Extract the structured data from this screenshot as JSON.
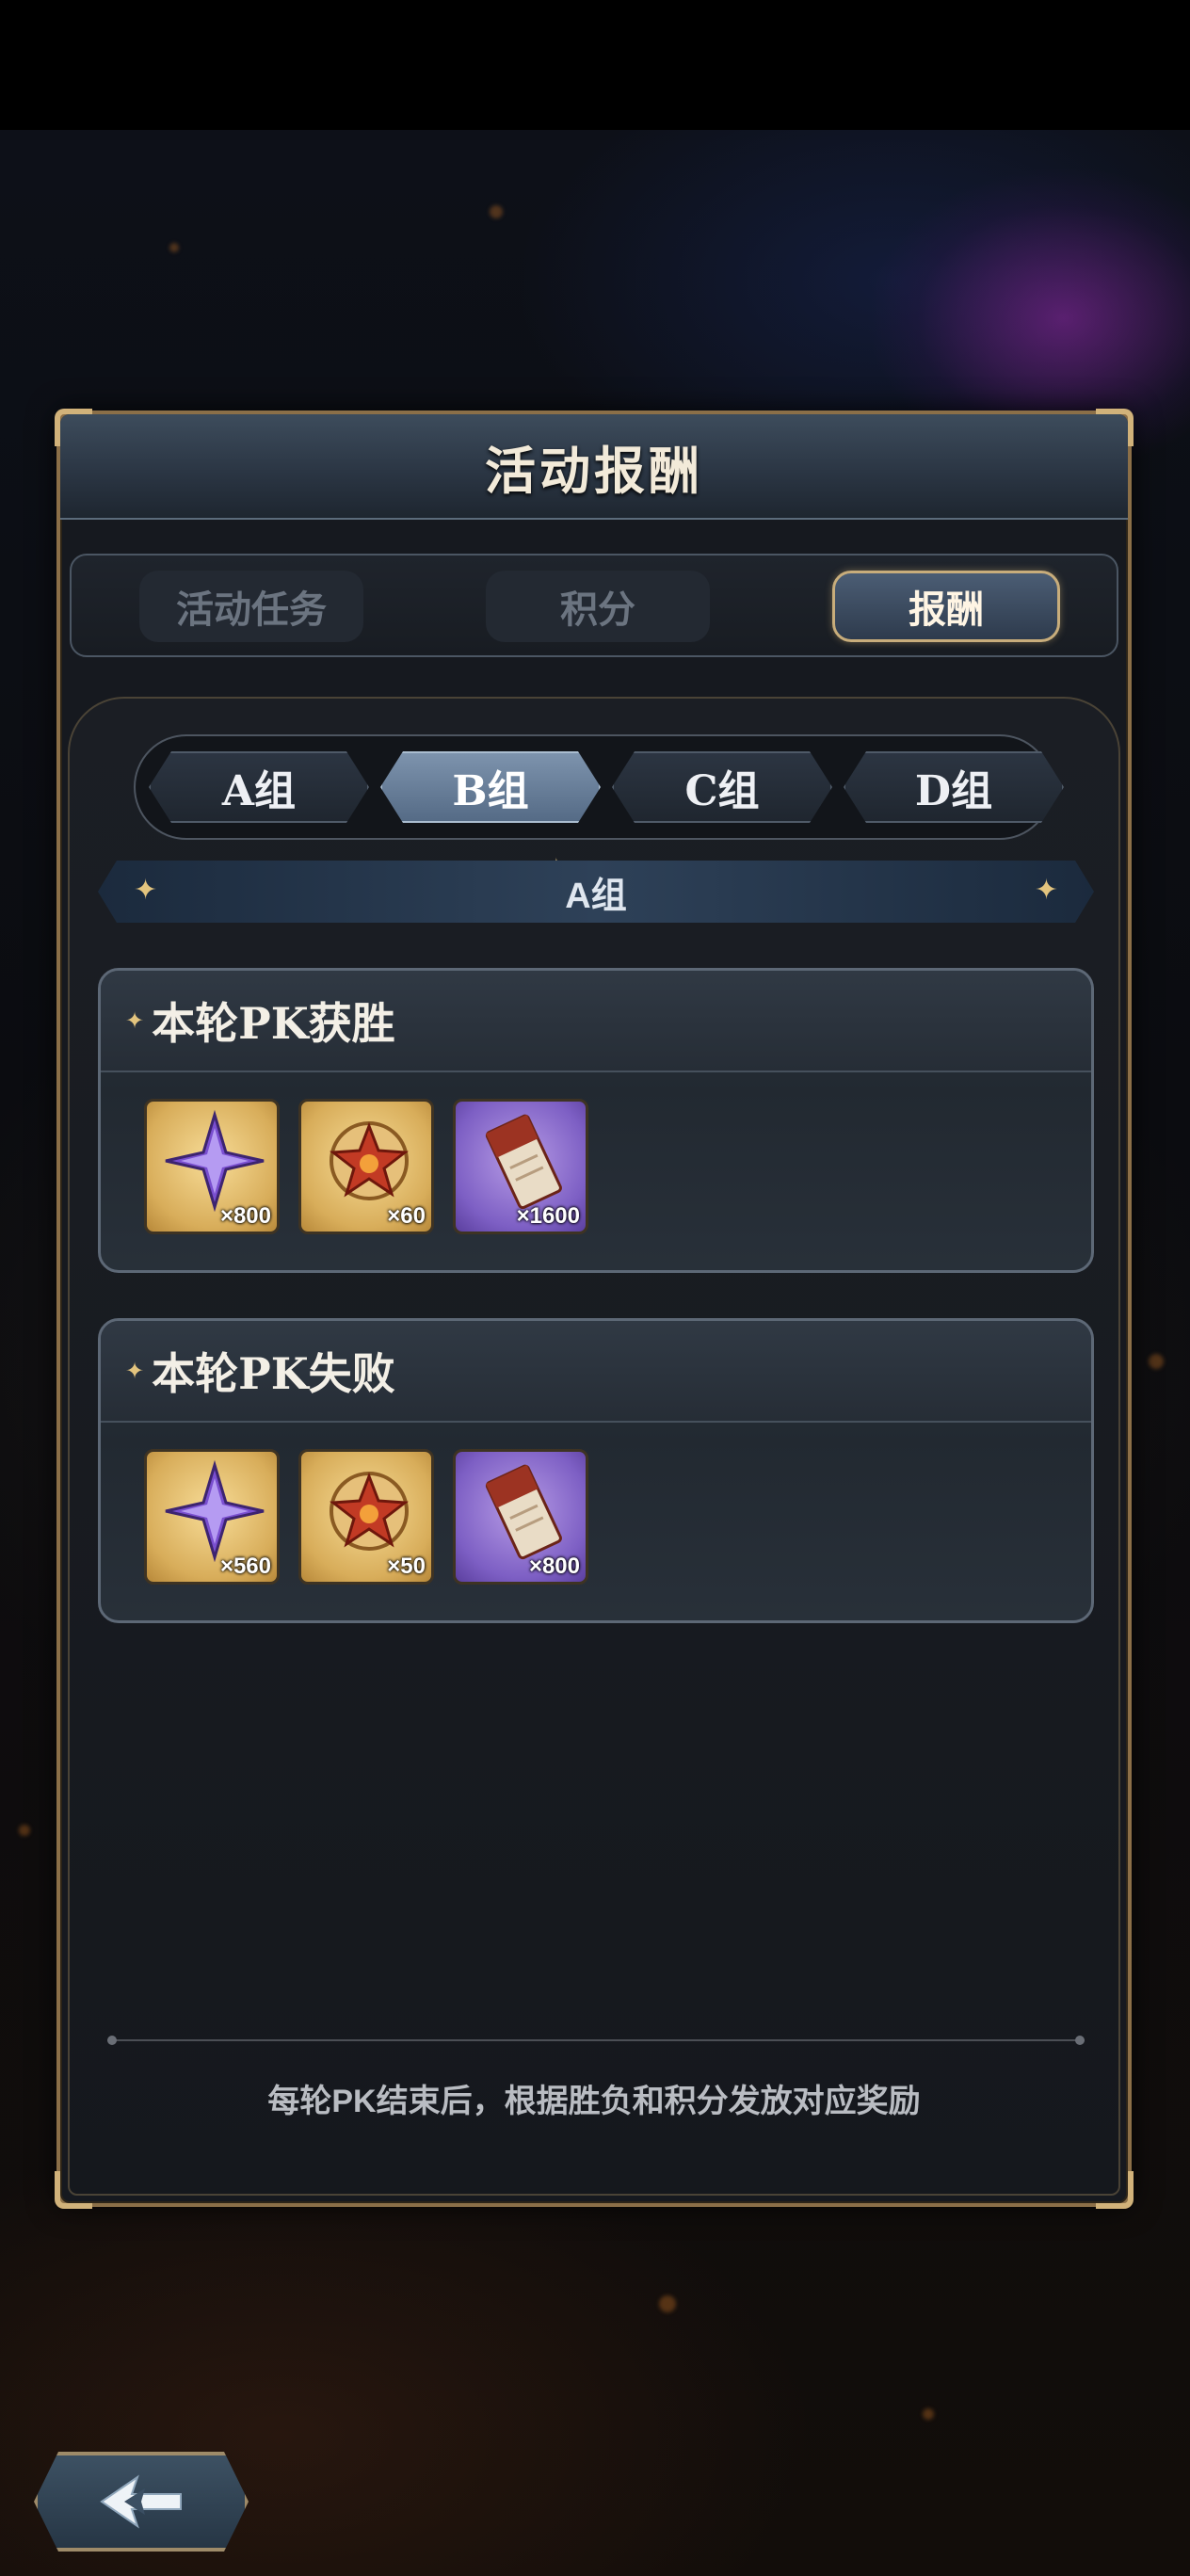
{
  "panel": {
    "title": "活动报酬"
  },
  "tabs": [
    {
      "label": "活动任务"
    },
    {
      "label": "积分"
    },
    {
      "label": "报酬"
    }
  ],
  "groups": [
    {
      "label": "A组"
    },
    {
      "label": "B组"
    },
    {
      "label": "C组"
    },
    {
      "label": "D组"
    }
  ],
  "section": {
    "label": "A组"
  },
  "rewards": [
    {
      "title": "本轮PK获胜",
      "items": [
        {
          "icon": "purple-star-crystal-icon",
          "qty": "×800"
        },
        {
          "icon": "red-star-medal-icon",
          "qty": "×60"
        },
        {
          "icon": "ticket-scroll-icon",
          "qty": "×1600"
        }
      ]
    },
    {
      "title": "本轮PK失败",
      "items": [
        {
          "icon": "purple-star-crystal-icon",
          "qty": "×560"
        },
        {
          "icon": "red-star-medal-icon",
          "qty": "×50"
        },
        {
          "icon": "ticket-scroll-icon",
          "qty": "×800"
        }
      ]
    }
  ],
  "footnote": "每轮PK结束后，根据胜负和积分发放对应奖励",
  "colors": {
    "accent_gold": "#c8ad7b",
    "panel_bg": "#16191f",
    "selected_tab": "#556b86"
  }
}
